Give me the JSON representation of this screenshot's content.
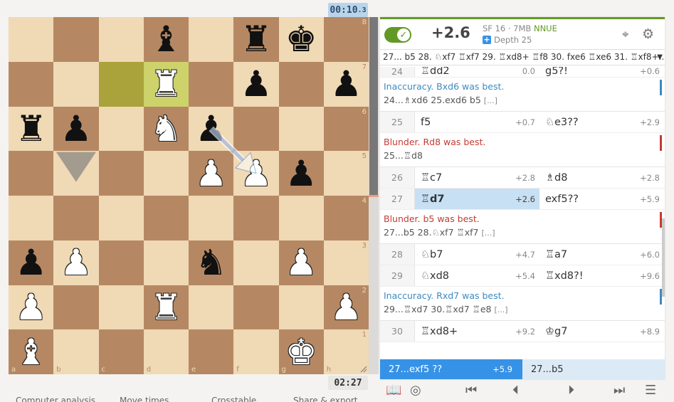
{
  "clock_top": {
    "main": "00:10",
    "tenths": ".3"
  },
  "clock_bottom": "02:27",
  "board": {
    "ranks": [
      "8",
      "7",
      "6",
      "5",
      "4",
      "3",
      "2",
      "1"
    ],
    "files": [
      "a",
      "b",
      "c",
      "d",
      "e",
      "f",
      "g",
      "h"
    ],
    "highlight": [
      "c7",
      "d7"
    ],
    "pieces": [
      {
        "square": "d8",
        "glyph": "♝",
        "color": "black"
      },
      {
        "square": "f8",
        "glyph": "♜",
        "color": "black"
      },
      {
        "square": "g8",
        "glyph": "♚",
        "color": "black"
      },
      {
        "square": "d7",
        "glyph": "♜",
        "color": "white"
      },
      {
        "square": "f7",
        "glyph": "♟",
        "color": "black"
      },
      {
        "square": "h7",
        "glyph": "♟",
        "color": "black"
      },
      {
        "square": "a6",
        "glyph": "♜",
        "color": "black"
      },
      {
        "square": "b6",
        "glyph": "♟",
        "color": "black"
      },
      {
        "square": "d6",
        "glyph": "♞",
        "color": "white"
      },
      {
        "square": "e6",
        "glyph": "♟",
        "color": "black"
      },
      {
        "square": "e5",
        "glyph": "♟",
        "color": "white"
      },
      {
        "square": "f5",
        "glyph": "♟",
        "color": "white"
      },
      {
        "square": "g5",
        "glyph": "♟",
        "color": "black"
      },
      {
        "square": "a3",
        "glyph": "♟",
        "color": "black"
      },
      {
        "square": "b3",
        "glyph": "♟",
        "color": "white"
      },
      {
        "square": "e3",
        "glyph": "♞",
        "color": "black"
      },
      {
        "square": "g3",
        "glyph": "♟",
        "color": "white"
      },
      {
        "square": "a2",
        "glyph": "♟",
        "color": "white"
      },
      {
        "square": "d2",
        "glyph": "♜",
        "color": "white"
      },
      {
        "square": "h2",
        "glyph": "♟",
        "color": "white"
      },
      {
        "square": "a1",
        "glyph": "♝",
        "color": "white"
      },
      {
        "square": "g1",
        "glyph": "♚",
        "color": "white"
      }
    ],
    "arrow": {
      "from": "e6",
      "to": "f5",
      "color": "#3a6ec2"
    },
    "shape_marker": {
      "square": "b5",
      "type": "down-triangle"
    }
  },
  "board_tabs": [
    "Computer analysis",
    "Move times",
    "Crosstable",
    "Share & export"
  ],
  "ceval": {
    "eval": "+2.6",
    "engine": "SF 16 · 7MB",
    "nnue": "NNUE",
    "depth": "Depth 25"
  },
  "pv_line": "27... b5 28. ♘xf7 ♖xf7 29. ♖xd8+ ♖f8 30. fxe6 ♖xe6 31. ♖xf8+...",
  "moves": [
    {
      "type": "row",
      "num": "24",
      "white": {
        "san": "♖dd2",
        "ev": "0.0"
      },
      "black": {
        "san": "g5?!",
        "ev": "+0.6",
        "cls": "inacc"
      },
      "first": true
    },
    {
      "type": "comment",
      "cls": "inacc",
      "head": "Inaccuracy. Bxd6 was best.",
      "var": "24...♗xd6 25.exd6 b5",
      "ell": "[...]"
    },
    {
      "type": "row",
      "num": "25",
      "white": {
        "san": "f5",
        "ev": "+0.7"
      },
      "black": {
        "san": "♘e3??",
        "ev": "+2.9",
        "cls": "blunder"
      }
    },
    {
      "type": "comment",
      "cls": "blunder",
      "head": "Blunder. Rd8 was best.",
      "var": "25...♖d8",
      "ell": ""
    },
    {
      "type": "row",
      "num": "26",
      "white": {
        "san": "♖c7",
        "ev": "+2.8"
      },
      "black": {
        "san": "♗d8",
        "ev": "+2.8"
      }
    },
    {
      "type": "row",
      "num": "27",
      "white": {
        "san": "♖d7",
        "ev": "+2.6",
        "active": true
      },
      "black": {
        "san": "exf5??",
        "ev": "+5.9",
        "cls": "blunder"
      }
    },
    {
      "type": "comment",
      "cls": "blunder",
      "head": "Blunder. b5 was best.",
      "var": "27...b5 28.♘xf7 ♖xf7",
      "ell": "[...]"
    },
    {
      "type": "row",
      "num": "28",
      "white": {
        "san": "♘b7",
        "ev": "+4.7"
      },
      "black": {
        "san": "♖a7",
        "ev": "+6.0"
      }
    },
    {
      "type": "row",
      "num": "29",
      "white": {
        "san": "♘xd8",
        "ev": "+5.4"
      },
      "black": {
        "san": "♖xd8?!",
        "ev": "+9.6",
        "cls": "inacc"
      }
    },
    {
      "type": "comment",
      "cls": "inacc",
      "head": "Inaccuracy. Rxd7 was best.",
      "var": "29...♖xd7 30.♖xd7 ♖e8",
      "ell": "[...]"
    },
    {
      "type": "row",
      "num": "30",
      "white": {
        "san": "♖xd8+",
        "ev": "+9.2"
      },
      "black": {
        "san": "♔g7",
        "ev": "+8.9"
      }
    }
  ],
  "fork": {
    "selected": {
      "san": "27...exf5 ??",
      "ev": "+5.9"
    },
    "other": {
      "san": "27...b5"
    }
  },
  "controls": {
    "book": "📖",
    "practice": "◎",
    "first": "⏮",
    "prev": "⏴",
    "next": "⏵",
    "last": "⏭",
    "menu": "☰"
  },
  "colors": {
    "accent": "#629924",
    "blunder": "#c43a33",
    "inaccuracy": "#3d8ac1",
    "selected": "#3692e7"
  }
}
